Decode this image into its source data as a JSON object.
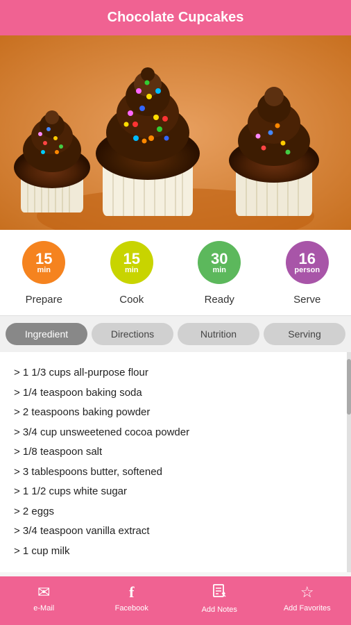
{
  "header": {
    "title": "Chocolate Cupcakes"
  },
  "stats": [
    {
      "value": "15",
      "unit": "min",
      "label": "Prepare",
      "color": "orange"
    },
    {
      "value": "15",
      "unit": "min",
      "label": "Cook",
      "color": "yellow-green"
    },
    {
      "value": "30",
      "unit": "min",
      "label": "Ready",
      "color": "green"
    },
    {
      "value": "16",
      "unit": "person",
      "label": "Serve",
      "color": "purple"
    }
  ],
  "tabs": [
    {
      "label": "Ingredient",
      "active": true
    },
    {
      "label": "Directions",
      "active": false
    },
    {
      "label": "Nutrition",
      "active": false
    },
    {
      "label": "Serving",
      "active": false
    }
  ],
  "ingredients": [
    "> 1 1/3 cups all-purpose flour",
    "> 1/4 teaspoon baking soda",
    "> 2 teaspoons baking powder",
    "> 3/4 cup unsweetened cocoa powder",
    "> 1/8 teaspoon salt",
    "> 3 tablespoons butter, softened",
    "> 1 1/2 cups white sugar",
    "> 2 eggs",
    "> 3/4 teaspoon vanilla extract",
    "> 1 cup milk"
  ],
  "bottom_bar": [
    {
      "icon": "✉",
      "label": "e-Mail",
      "name": "email"
    },
    {
      "icon": "f",
      "label": "Facebook",
      "name": "facebook"
    },
    {
      "icon": "✎",
      "label": "Add Notes",
      "name": "add-notes"
    },
    {
      "icon": "☆",
      "label": "Add Favorites",
      "name": "add-favorites"
    }
  ]
}
